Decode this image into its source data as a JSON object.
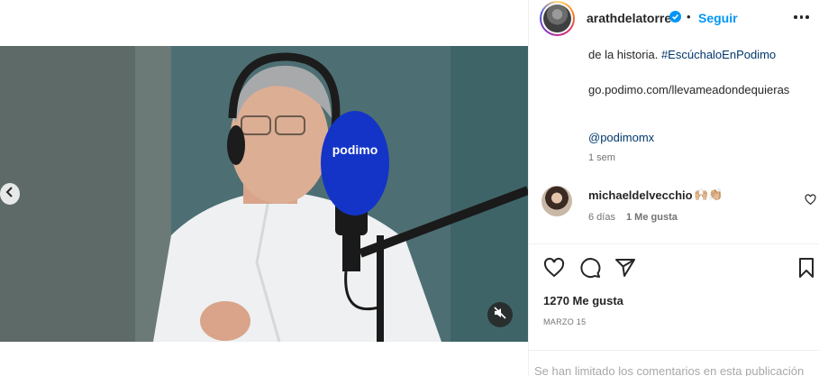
{
  "post": {
    "username": "arathdelatorre",
    "follow_label": "Seguir",
    "separator": "•",
    "caption_line": "de la historia.",
    "hashtag": "#EscúchaloEnPodimo",
    "link": "go.podimo.com/llevameadondequieras",
    "mention": "@podimomx",
    "time_ago": "1 sem",
    "likes_total": "1270 Me gusta",
    "date": "MARZO 15",
    "comments_limited": "Se han limitado los comentarios en esta publicación"
  },
  "media": {
    "mic_brand": "podimo",
    "colors": {
      "wall": "#4d6f73",
      "mic": "#1434c8",
      "shirt": "#eef0f2"
    }
  },
  "comment": {
    "username": "michaeldelvecchio",
    "text": "🙌🏼👏🏼",
    "time": "6 días",
    "likes": "1 Me gusta"
  },
  "icons": {
    "prev": "chevron-left-icon",
    "mute": "muted-speaker-icon",
    "more": "more-options-icon",
    "verified": "verified-badge-icon",
    "like": "heart-icon",
    "comment": "comment-icon",
    "share": "share-icon",
    "save": "bookmark-icon"
  }
}
